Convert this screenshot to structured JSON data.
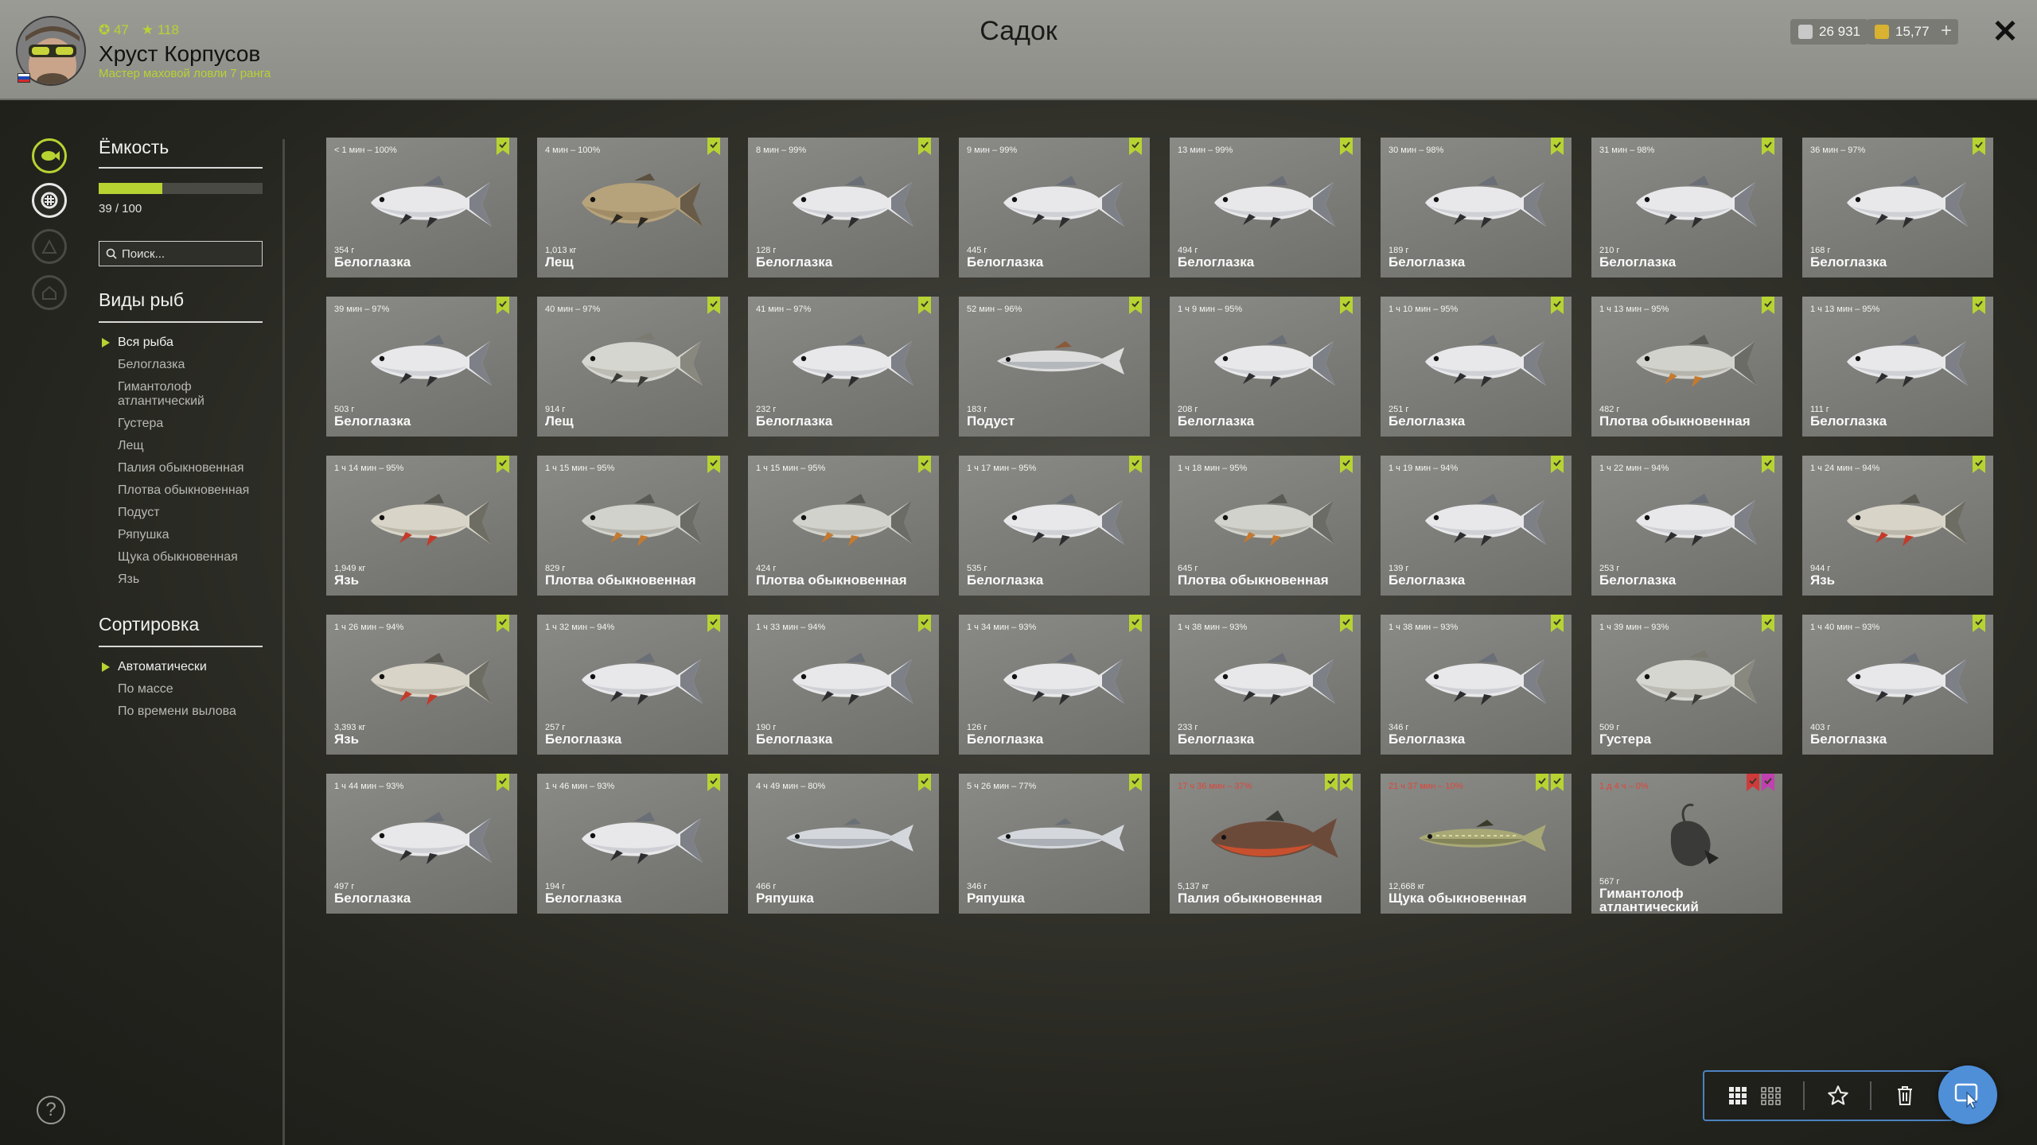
{
  "window": {
    "title": "Садок"
  },
  "player": {
    "name": "Хруст Корпусов",
    "rank": "Мастер маховой ловли 7 ранга",
    "level": "47",
    "stars": "118"
  },
  "currency": {
    "silver": "26 931",
    "gold": "15,77"
  },
  "sidebar": {
    "capacity_title": "Ёмкость",
    "capacity_text": "39 / 100",
    "capacity_fraction": 0.39,
    "search_placeholder": "Поиск...",
    "species_title": "Виды рыб",
    "species": [
      {
        "label": "Вся рыба",
        "active": true
      },
      {
        "label": "Белоглазка"
      },
      {
        "label": "Гимантолоф атлантический"
      },
      {
        "label": "Густера"
      },
      {
        "label": "Лещ"
      },
      {
        "label": "Палия обыкновенная"
      },
      {
        "label": "Плотва обыкновенная"
      },
      {
        "label": "Подуст"
      },
      {
        "label": "Ряпушка"
      },
      {
        "label": "Щука обыкновенная"
      },
      {
        "label": "Язь"
      }
    ],
    "sort_title": "Сортировка",
    "sort_options": [
      {
        "label": "Автоматически",
        "active": true
      },
      {
        "label": "По массе"
      },
      {
        "label": "По времени вылова"
      }
    ]
  },
  "colors": {
    "accent": "#b7d332",
    "bookmark_green": "#b7d332",
    "bookmark_pink": "#c040b0",
    "bookmark_red": "#d03a3a",
    "time_red": "#e0463a",
    "toolbar_blue": "#4e8fd8"
  },
  "fish": [
    {
      "time": "< 1 мин – 100%",
      "weight": "354 г",
      "name": "Белоглазка",
      "kind": "bream-white",
      "marks": [
        "green"
      ]
    },
    {
      "time": "4 мин – 100%",
      "weight": "1,013 кг",
      "name": "Лещ",
      "kind": "bream-bronze",
      "marks": [
        "green"
      ]
    },
    {
      "time": "8 мин – 99%",
      "weight": "128 г",
      "name": "Белоглазка",
      "kind": "bream-white",
      "marks": [
        "green"
      ]
    },
    {
      "time": "9 мин – 99%",
      "weight": "445 г",
      "name": "Белоглазка",
      "kind": "bream-white",
      "marks": [
        "green"
      ]
    },
    {
      "time": "13 мин – 99%",
      "weight": "494 г",
      "name": "Белоглазка",
      "kind": "bream-white",
      "marks": [
        "green"
      ]
    },
    {
      "time": "30 мин – 98%",
      "weight": "189 г",
      "name": "Белоглазка",
      "kind": "bream-white",
      "marks": [
        "green"
      ]
    },
    {
      "time": "31 мин – 98%",
      "weight": "210 г",
      "name": "Белоглазка",
      "kind": "bream-white",
      "marks": [
        "green"
      ]
    },
    {
      "time": "36 мин – 97%",
      "weight": "168 г",
      "name": "Белоглазка",
      "kind": "bream-white",
      "marks": [
        "green"
      ]
    },
    {
      "time": "39 мин – 97%",
      "weight": "503 г",
      "name": "Белоглазка",
      "kind": "bream-white",
      "marks": [
        "green"
      ]
    },
    {
      "time": "40 мин – 97%",
      "weight": "914 г",
      "name": "Лещ",
      "kind": "bream-silver",
      "marks": [
        "green"
      ]
    },
    {
      "time": "41 мин – 97%",
      "weight": "232 г",
      "name": "Белоглазка",
      "kind": "bream-white",
      "marks": [
        "green"
      ]
    },
    {
      "time": "52 мин – 96%",
      "weight": "183 г",
      "name": "Подуст",
      "kind": "podust",
      "marks": [
        "green"
      ]
    },
    {
      "time": "1 ч 9 мин – 95%",
      "weight": "208 г",
      "name": "Белоглазка",
      "kind": "bream-white",
      "marks": [
        "green"
      ]
    },
    {
      "time": "1 ч 10 мин – 95%",
      "weight": "251 г",
      "name": "Белоглазка",
      "kind": "bream-white",
      "marks": [
        "green"
      ]
    },
    {
      "time": "1 ч 13 мин – 95%",
      "weight": "482 г",
      "name": "Плотва обыкновенная",
      "kind": "roach",
      "marks": [
        "green"
      ]
    },
    {
      "time": "1 ч 13 мин – 95%",
      "weight": "111 г",
      "name": "Белоглазка",
      "kind": "bream-white",
      "marks": [
        "green"
      ]
    },
    {
      "time": "1 ч 14 мин – 95%",
      "weight": "1,949 кг",
      "name": "Язь",
      "kind": "ide",
      "marks": [
        "green"
      ]
    },
    {
      "time": "1 ч 15 мин – 95%",
      "weight": "829 г",
      "name": "Плотва обыкновенная",
      "kind": "roach",
      "marks": [
        "green"
      ]
    },
    {
      "time": "1 ч 15 мин – 95%",
      "weight": "424 г",
      "name": "Плотва обыкновенная",
      "kind": "roach",
      "marks": [
        "green"
      ]
    },
    {
      "time": "1 ч 17 мин – 95%",
      "weight": "535 г",
      "name": "Белоглазка",
      "kind": "bream-white",
      "marks": [
        "green"
      ]
    },
    {
      "time": "1 ч 18 мин – 95%",
      "weight": "645 г",
      "name": "Плотва обыкновенная",
      "kind": "roach",
      "marks": [
        "green"
      ]
    },
    {
      "time": "1 ч 19 мин – 94%",
      "weight": "139 г",
      "name": "Белоглазка",
      "kind": "bream-white",
      "marks": [
        "green"
      ]
    },
    {
      "time": "1 ч 22 мин – 94%",
      "weight": "253 г",
      "name": "Белоглазка",
      "kind": "bream-white",
      "marks": [
        "green"
      ]
    },
    {
      "time": "1 ч 24 мин – 94%",
      "weight": "944 г",
      "name": "Язь",
      "kind": "ide",
      "marks": [
        "green"
      ]
    },
    {
      "time": "1 ч 26 мин – 94%",
      "weight": "3,393 кг",
      "name": "Язь",
      "kind": "ide",
      "marks": [
        "green"
      ]
    },
    {
      "time": "1 ч 32 мин – 94%",
      "weight": "257 г",
      "name": "Белоглазка",
      "kind": "bream-white",
      "marks": [
        "green"
      ]
    },
    {
      "time": "1 ч 33 мин – 94%",
      "weight": "190 г",
      "name": "Белоглазка",
      "kind": "bream-white",
      "marks": [
        "green"
      ]
    },
    {
      "time": "1 ч 34 мин – 93%",
      "weight": "126 г",
      "name": "Белоглазка",
      "kind": "bream-white",
      "marks": [
        "green"
      ]
    },
    {
      "time": "1 ч 38 мин – 93%",
      "weight": "233 г",
      "name": "Белоглазка",
      "kind": "bream-white",
      "marks": [
        "green"
      ]
    },
    {
      "time": "1 ч 38 мин – 93%",
      "weight": "346 г",
      "name": "Белоглазка",
      "kind": "bream-white",
      "marks": [
        "green"
      ]
    },
    {
      "time": "1 ч 39 мин – 93%",
      "weight": "509 г",
      "name": "Густера",
      "kind": "bream-silver",
      "marks": [
        "green"
      ]
    },
    {
      "time": "1 ч 40 мин – 93%",
      "weight": "403 г",
      "name": "Белоглазка",
      "kind": "bream-white",
      "marks": [
        "green"
      ]
    },
    {
      "time": "1 ч 44 мин – 93%",
      "weight": "497 г",
      "name": "Белоглазка",
      "kind": "bream-white",
      "marks": [
        "green"
      ]
    },
    {
      "time": "1 ч 46 мин – 93%",
      "weight": "194 г",
      "name": "Белоглазка",
      "kind": "bream-white",
      "marks": [
        "green"
      ]
    },
    {
      "time": "4 ч 49 мин – 80%",
      "weight": "466 г",
      "name": "Ряпушка",
      "kind": "vendace",
      "marks": [
        "green"
      ]
    },
    {
      "time": "5 ч 26 мин – 77%",
      "weight": "346 г",
      "name": "Ряпушка",
      "kind": "vendace",
      "marks": [
        "green"
      ]
    },
    {
      "time": "17 ч 36 мин – 37%",
      "weight": "5,137 кг",
      "name": "Палия обыкновенная",
      "kind": "char",
      "marks": [
        "green",
        "yellow"
      ],
      "time_red": true
    },
    {
      "time": "21 ч 37 мин – 10%",
      "weight": "12,668 кг",
      "name": "Щука обыкновенная",
      "kind": "pike",
      "marks": [
        "green",
        "yellow"
      ],
      "time_red": true
    },
    {
      "time": "1 д 4 ч – 0%",
      "weight": "567 г",
      "name": "Гимантолоф атлантический",
      "kind": "angler",
      "marks": [
        "red",
        "pink"
      ],
      "time_red": true
    }
  ],
  "toolbar": {
    "icons": [
      "grid-large-icon",
      "grid-small-icon",
      "star-icon",
      "trash-icon",
      "cursor-icon"
    ]
  },
  "help": "?"
}
